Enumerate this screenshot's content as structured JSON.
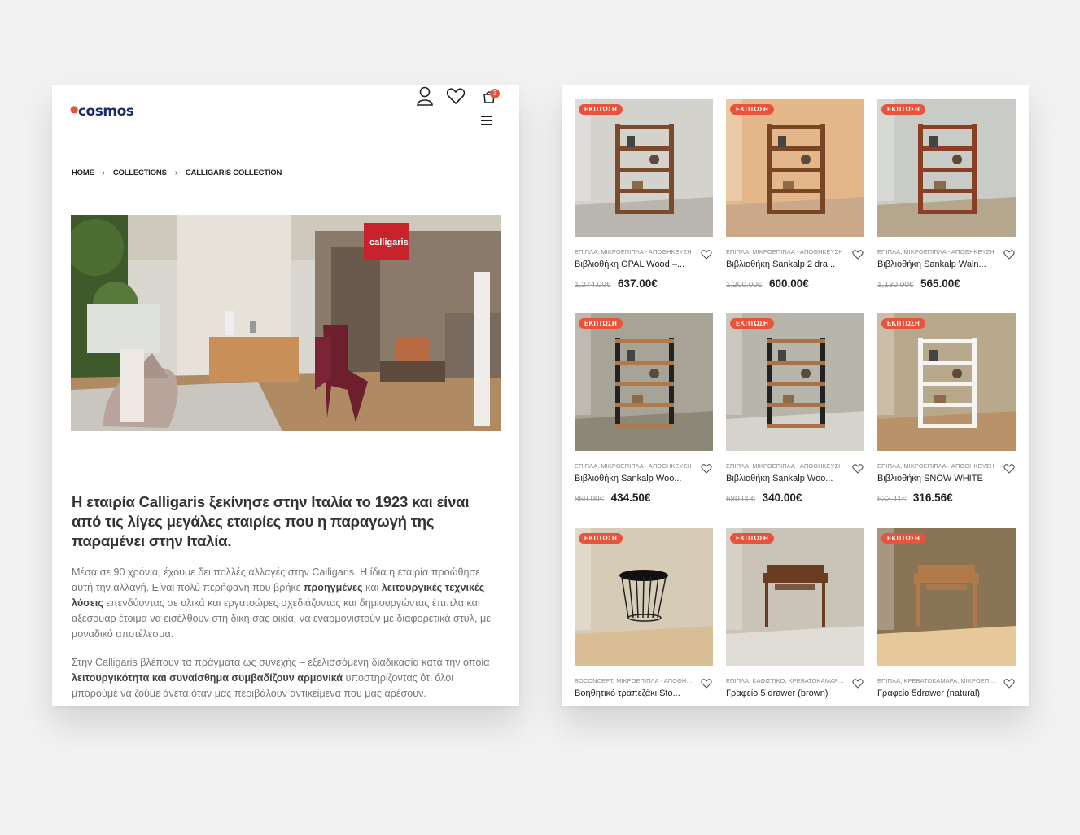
{
  "mobile_page": {
    "logo_text": "cosmos",
    "cart_count": "3",
    "breadcrumb": [
      "HOME",
      "COLLECTIONS",
      "CALLIGARIS COLLECTION"
    ],
    "hero_sign_text": "calligaris",
    "heading": "Η εταιρία Calligaris ξεκίνησε στην Ιταλία το 1923 και είναι από τις λίγες μεγάλες εταιρίες που η παραγωγή της παραμένει στην Ιταλία.",
    "paragraph1": {
      "t1": "Μέσα σε 90 χρόνια, έχουμε δει πολλές αλλαγές στην Calligaris. Η ίδια η εταιρία προώθησε αυτή την αλλαγή. Είναι πολύ περήφανη που βρήκε ",
      "b1": "προηγμένες",
      "t2": " και ",
      "b2": "λειτουργικές τεχνικές λύσεις",
      "t3": " επενδύοντας σε υλικά και εργατοώρες σχεδιάζοντας και δημιουργώντας έπιπλα και αξεσουάρ έτοιμα να εισέλθουν στη δική σας οικία, να εναρμονιστούν με διαφορετικά στυλ, με μοναδικό αποτέλεσμα."
    },
    "paragraph2": {
      "t1": "Στην Calligaris βλέπουν τα πράγματα ως συνεχής – εξελισσόμενη διαδικασία κατά την οποία ",
      "b1": "λειτουργικότητα και συναίσθημα συμβαδίζουν αρμονικά",
      "t2": " υποστηρίζοντας ότι όλοι μπορούμε να ζούμε άνετα όταν μας περιβάλουν αντικείμενα που μας αρέσουν."
    }
  },
  "products": [
    {
      "badge": "ΕΚΠΤΩΣΗ",
      "category": "ΕΠΙΠΛΑ, ΜΙΚΡΟΕΠΙΠΛΑ - ΑΠΟΘΗΚΕΥΣΗ",
      "title": "Βιβλιοθήκη OPAL Wood –...",
      "old_price": "1,274.00€",
      "price": "637.00€",
      "scene": "shelf-grey"
    },
    {
      "badge": "ΕΚΠΤΩΣΗ",
      "category": "ΕΠΙΠΛΑ, ΜΙΚΡΟΕΠΙΠΛΑ - ΑΠΟΘΗΚΕΥΣΗ",
      "title": "Βιβλιοθήκη Sankalp 2 dra...",
      "old_price": "1,200.00€",
      "price": "600.00€",
      "scene": "shelf-warm"
    },
    {
      "badge": "ΕΚΠΤΩΣΗ",
      "category": "ΕΠΙΠΛΑ, ΜΙΚΡΟΕΠΙΠΛΑ - ΑΠΟΘΗΚΕΥΣΗ",
      "title": "Βιβλιοθήκη Sankalp Waln...",
      "old_price": "1,130.00€",
      "price": "565.00€",
      "scene": "shelf-tall"
    },
    {
      "badge": "ΕΚΠΤΩΣΗ",
      "category": "ΕΠΙΠΛΑ, ΜΙΚΡΟΕΠΙΠΛΑ - ΑΠΟΘΗΚΕΥΣΗ",
      "title": "Βιβλιοθήκη Sankalp Woo...",
      "old_price": "869.00€",
      "price": "434.50€",
      "scene": "shelf-metal"
    },
    {
      "badge": "ΕΚΠΤΩΣΗ",
      "category": "ΕΠΙΠΛΑ, ΜΙΚΡΟΕΠΙΠΛΑ - ΑΠΟΘΗΚΕΥΣΗ",
      "title": "Βιβλιοθήκη Sankalp Woo...",
      "old_price": "680.00€",
      "price": "340.00€",
      "scene": "shelf-metal2"
    },
    {
      "badge": "ΕΚΠΤΩΣΗ",
      "category": "ΕΠΙΠΛΑ, ΜΙΚΡΟΕΠΙΠΛΑ - ΑΠΟΘΗΚΕΥΣΗ",
      "title": "Βιβλιοθήκη SNOW WHITE",
      "old_price": "633.11€",
      "price": "316.56€",
      "scene": "shelf-white"
    },
    {
      "badge": "ΕΚΠΤΩΣΗ",
      "category": "BOCONCEPT, ΜΙΚΡΟΕΠΙΠΛΑ - ΑΠΟΘΗΚ...",
      "title": "Βοηθητικό τραπεζάκι Sto...",
      "old_price": "",
      "price": "",
      "scene": "side-table"
    },
    {
      "badge": "ΕΚΠΤΩΣΗ",
      "category": "ΕΠΙΠΛΑ, ΚΑΘΙΣΤΙΚΟ, ΚΡΕΒΑΤΟΚΑΜΑΡΑ, ...",
      "title": "Γραφείο 5 drawer (brown)",
      "old_price": "",
      "price": "",
      "scene": "desk-brown"
    },
    {
      "badge": "ΕΚΠΤΩΣΗ",
      "category": "ΕΠΙΠΛΑ, ΚΡΕΒΑΤΟΚΑΜΑΡΑ, ΜΙΚΡΟΕΠΙΠ...",
      "title": "Γραφείο 5drawer (natural)",
      "old_price": "",
      "price": "",
      "scene": "desk-natural"
    }
  ]
}
